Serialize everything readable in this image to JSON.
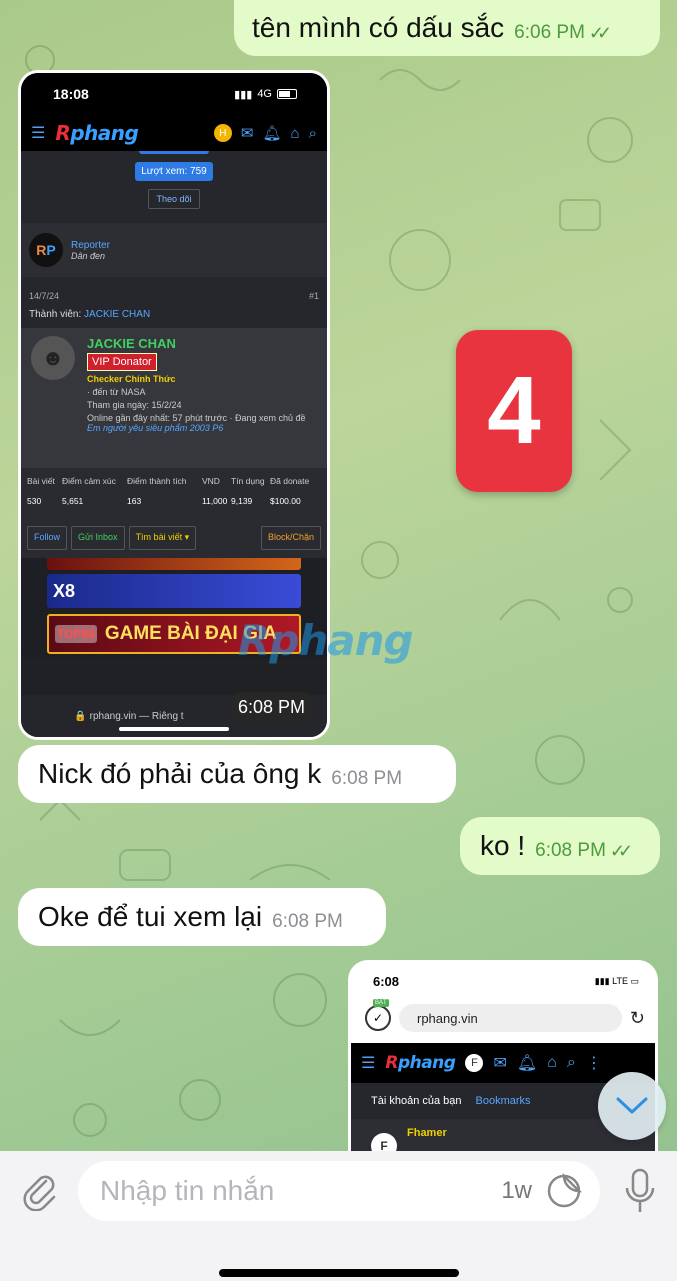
{
  "messages": [
    {
      "text": "tên mình có dấu sắc",
      "time": "6:06 PM",
      "ticks": "✓✓"
    },
    {
      "text": "Nick đó phải của ông k",
      "time": "6:08 PM"
    },
    {
      "text": "ko !",
      "time": "6:08 PM",
      "ticks": "✓✓"
    },
    {
      "text": "Oke để tui xem lại",
      "time": "6:08 PM"
    }
  ],
  "shot1": {
    "clock": "18:08",
    "network": "4G",
    "time_overlay": "6:08 PM",
    "logo_r": "R",
    "logo_rest": "phang",
    "coin": "H",
    "views_button": "Lượt xem: 759",
    "follow_small": "Theo dõi",
    "reporter_avatar_r": "R",
    "reporter_avatar_p": "P",
    "reporter_name": "Reporter",
    "reporter_sub": "Dân đen",
    "post_date": "14/7/24",
    "post_number": "#1",
    "member_label": "Thành viên:",
    "member_name": "JACKIE CHAN",
    "profile": {
      "name": "JACKIE CHAN",
      "badge": "VIP Donator",
      "role": "Checker Chính Thức",
      "from": "· đến từ NASA",
      "joined": "Tham gia ngày: 15/2/24",
      "online": "Online gần đây nhất: 57 phút trước · Đang xem chủ đề",
      "online_link": "Em người yêu siêu phẩm 2003 P6"
    },
    "stats": [
      {
        "label": "Bài viết",
        "value": "530"
      },
      {
        "label": "Điểm cảm xúc",
        "value": "5,651"
      },
      {
        "label": "Điểm thành tích",
        "value": "163"
      },
      {
        "label": "VND",
        "value": "11,000"
      },
      {
        "label": "Tín dụng",
        "value": "9,139"
      },
      {
        "label": "Đã donate",
        "value": "$100.00"
      }
    ],
    "actions": {
      "follow": "Follow",
      "inbox": "Gửi Inbox",
      "find": "Tìm bài viết ▾",
      "block": "Block/Chặn"
    },
    "banner_x8": "X8",
    "banner_top88": "TOP88",
    "banner_game": "GAME BÀI ĐẠI GIA",
    "url": "🔒 rphang.vin — Riêng t"
  },
  "watermark": "Rphang",
  "sticker": "4",
  "shot2": {
    "clock": "6:08",
    "network": "LTE",
    "shield_badge": "BẬT",
    "address": "rphang.vin",
    "logo_r": "R",
    "logo_rest": "phang",
    "tab_account": "Tài khoản của bạn",
    "tab_bookmarks": "Bookmarks",
    "user_name": "Fhamer",
    "user_avatar": "F"
  },
  "composer": {
    "placeholder": "Nhập tin nhắn",
    "timer_label": "1w"
  },
  "colors": {
    "out_bubble": "#e3fbc9",
    "in_bubble": "#ffffff",
    "out_time": "#4f9a3d",
    "sticker": "#e8343e"
  }
}
